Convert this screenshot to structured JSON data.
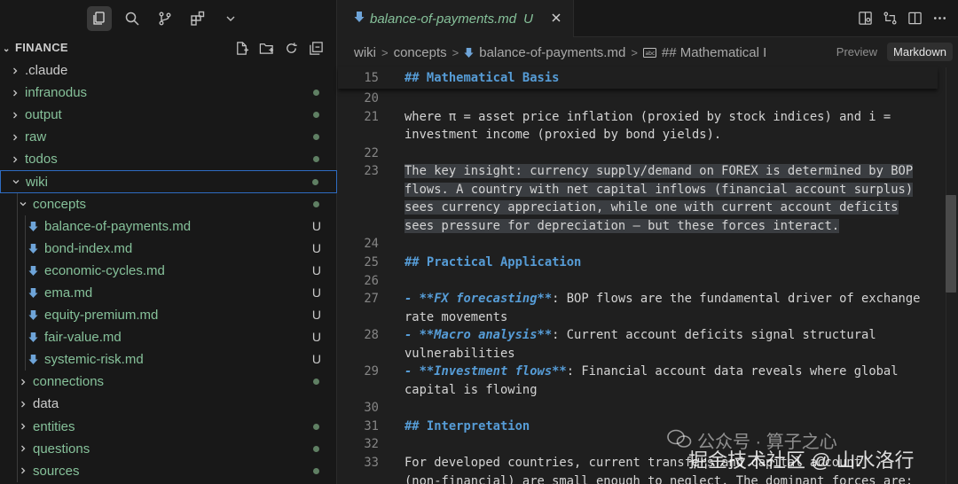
{
  "colors": {
    "untracked_green": "#86c19a",
    "keyword_blue": "#569cd6",
    "selection": "#3a3d41",
    "folder_outline": "#2e6cc2"
  },
  "activity_bar": [
    {
      "name": "explorer-icon",
      "active": true
    },
    {
      "name": "search-icon"
    },
    {
      "name": "source-control-icon"
    },
    {
      "name": "extensions-icon"
    },
    {
      "name": "chevron-down-icon"
    }
  ],
  "explorer": {
    "title": "FINANCE",
    "actions": [
      "new-file-icon",
      "new-folder-icon",
      "refresh-icon",
      "collapse-all-icon"
    ]
  },
  "tree": [
    {
      "label": ".claude",
      "type": "folder",
      "depth": 0,
      "expanded": false
    },
    {
      "label": "infranodus",
      "type": "folder",
      "depth": 0,
      "expanded": false,
      "status": "dot",
      "untracked": true
    },
    {
      "label": "output",
      "type": "folder",
      "depth": 0,
      "expanded": false,
      "status": "dot",
      "untracked": true
    },
    {
      "label": "raw",
      "type": "folder",
      "depth": 0,
      "expanded": false,
      "status": "dot",
      "untracked": true
    },
    {
      "label": "todos",
      "type": "folder",
      "depth": 0,
      "expanded": false,
      "status": "dot",
      "untracked": true
    },
    {
      "label": "wiki",
      "type": "folder",
      "depth": 0,
      "expanded": true,
      "status": "dot",
      "untracked": true,
      "selected": true
    },
    {
      "label": "concepts",
      "type": "folder",
      "depth": 1,
      "expanded": true,
      "status": "dot",
      "untracked": true
    },
    {
      "label": "balance-of-payments.md",
      "type": "file",
      "depth": 2,
      "status": "U",
      "untracked": true
    },
    {
      "label": "bond-index.md",
      "type": "file",
      "depth": 2,
      "status": "U",
      "untracked": true
    },
    {
      "label": "economic-cycles.md",
      "type": "file",
      "depth": 2,
      "status": "U",
      "untracked": true
    },
    {
      "label": "ema.md",
      "type": "file",
      "depth": 2,
      "status": "U",
      "untracked": true
    },
    {
      "label": "equity-premium.md",
      "type": "file",
      "depth": 2,
      "status": "U",
      "untracked": true
    },
    {
      "label": "fair-value.md",
      "type": "file",
      "depth": 2,
      "status": "U",
      "untracked": true
    },
    {
      "label": "systemic-risk.md",
      "type": "file",
      "depth": 2,
      "status": "U",
      "untracked": true
    },
    {
      "label": "connections",
      "type": "folder",
      "depth": 1,
      "expanded": false,
      "status": "dot",
      "untracked": true
    },
    {
      "label": "data",
      "type": "folder",
      "depth": 1,
      "expanded": false
    },
    {
      "label": "entities",
      "type": "folder",
      "depth": 1,
      "expanded": false,
      "status": "dot",
      "untracked": true
    },
    {
      "label": "questions",
      "type": "folder",
      "depth": 1,
      "expanded": false,
      "status": "dot",
      "untracked": true
    },
    {
      "label": "sources",
      "type": "folder",
      "depth": 1,
      "expanded": false,
      "status": "dot",
      "untracked": true
    }
  ],
  "tab": {
    "title": "balance-of-payments.md",
    "status": "U"
  },
  "editor_actions": [
    "open-preview-icon",
    "compare-changes-icon",
    "split-editor-icon",
    "more-actions-icon"
  ],
  "breadcrumb": {
    "items": [
      "wiki",
      "concepts",
      "balance-of-payments.md",
      "## Mathematical I"
    ]
  },
  "view_modes": {
    "preview": "Preview",
    "markdown": "Markdown",
    "active": "Markdown"
  },
  "sticky_header": {
    "line": "15",
    "text": "## Mathematical Basis"
  },
  "code_lines": [
    {
      "ln": "20",
      "segments": [
        {
          "t": ""
        }
      ]
    },
    {
      "ln": "21",
      "segments": [
        {
          "t": "where π = asset price inflation (proxied by stock indices) and i ="
        }
      ]
    },
    {
      "ln": "",
      "segments": [
        {
          "t": "investment income (proxied by bond yields)."
        }
      ]
    },
    {
      "ln": "22",
      "segments": [
        {
          "t": ""
        }
      ]
    },
    {
      "ln": "23",
      "highlight": true,
      "segments": [
        {
          "t": "The key insight: currency supply/demand on FOREX is determined by BOP"
        }
      ]
    },
    {
      "ln": "",
      "highlight": true,
      "segments": [
        {
          "t": "flows. A country with net capital inflows (financial account surplus)"
        }
      ]
    },
    {
      "ln": "",
      "highlight": true,
      "segments": [
        {
          "t": "sees currency appreciation, while one with current account deficits"
        }
      ]
    },
    {
      "ln": "",
      "highlight": true,
      "segments": [
        {
          "t": "sees pressure for depreciation — but these forces interact."
        }
      ]
    },
    {
      "ln": "24",
      "segments": [
        {
          "t": ""
        }
      ]
    },
    {
      "ln": "25",
      "segments": [
        {
          "t": "## Practical Application",
          "c": "h"
        }
      ]
    },
    {
      "ln": "26",
      "segments": [
        {
          "t": ""
        }
      ]
    },
    {
      "ln": "27",
      "segments": [
        {
          "t": "- **FX forecasting**",
          "c": "b"
        },
        {
          "t": ": BOP flows are the fundamental driver of exchange"
        }
      ]
    },
    {
      "ln": "",
      "segments": [
        {
          "t": "rate movements"
        }
      ]
    },
    {
      "ln": "28",
      "segments": [
        {
          "t": "- **Macro analysis**",
          "c": "b"
        },
        {
          "t": ": Current account deficits signal structural"
        }
      ]
    },
    {
      "ln": "",
      "segments": [
        {
          "t": "vulnerabilities"
        }
      ]
    },
    {
      "ln": "29",
      "segments": [
        {
          "t": "- **Investment flows**",
          "c": "b"
        },
        {
          "t": ": Financial account data reveals where global"
        }
      ]
    },
    {
      "ln": "",
      "segments": [
        {
          "t": "capital is flowing"
        }
      ]
    },
    {
      "ln": "30",
      "segments": [
        {
          "t": ""
        }
      ]
    },
    {
      "ln": "31",
      "segments": [
        {
          "t": "## Interpretation",
          "c": "h"
        }
      ]
    },
    {
      "ln": "32",
      "segments": [
        {
          "t": ""
        }
      ]
    },
    {
      "ln": "33",
      "segments": [
        {
          "t": "For developed countries, current transfers and capital account"
        }
      ]
    },
    {
      "ln": "",
      "segments": [
        {
          "t": "(non-financial) are small enough to neglect. The dominant forces are:"
        }
      ]
    }
  ],
  "watermark": {
    "line1": "公众号 · 算子之心",
    "line2": "掘金技术社区 @ 山水洛行"
  }
}
